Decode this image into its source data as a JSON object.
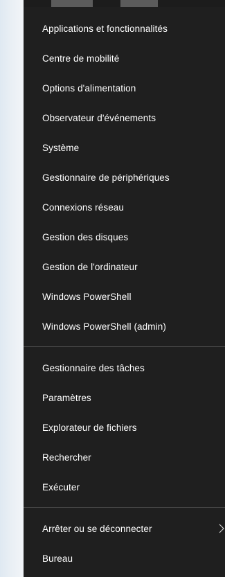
{
  "menu": {
    "items": [
      {
        "label": "Applications et fonctionnalités"
      },
      {
        "label": "Centre de mobilité"
      },
      {
        "label": "Options d'alimentation"
      },
      {
        "label": "Observateur d'événements"
      },
      {
        "label": "Système"
      },
      {
        "label": "Gestionnaire de périphériques"
      },
      {
        "label": "Connexions réseau"
      },
      {
        "label": "Gestion des disques"
      },
      {
        "label": "Gestion de l'ordinateur"
      },
      {
        "label": "Windows PowerShell"
      },
      {
        "label": "Windows PowerShell (admin)"
      },
      {
        "label": "Gestionnaire des tâches"
      },
      {
        "label": "Paramètres"
      },
      {
        "label": "Explorateur de fichiers"
      },
      {
        "label": "Rechercher"
      },
      {
        "label": "Exécuter"
      },
      {
        "label": "Arrêter ou se déconnecter"
      },
      {
        "label": "Bureau"
      }
    ],
    "submenu_icon": "chevron-right-icon"
  },
  "colors": {
    "menu_background": "#1f1f1f",
    "text": "#ffffff",
    "separator": "#4a4a4a"
  }
}
